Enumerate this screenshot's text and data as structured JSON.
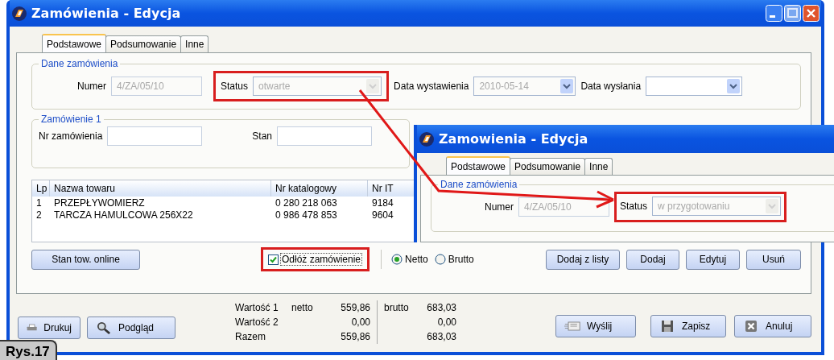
{
  "window": {
    "title": "Zamówienia - Edycja"
  },
  "tabs": [
    {
      "label": "Podstawowe",
      "selected": true
    },
    {
      "label": "Podsumowanie",
      "selected": false
    },
    {
      "label": "Inne",
      "selected": false
    }
  ],
  "order_data": {
    "legend": "Dane zamówienia",
    "numer": {
      "label": "Numer",
      "value": "4/ZA/05/10"
    },
    "status": {
      "label": "Status",
      "value": "otwarte",
      "highlighted": true
    },
    "issue_date": {
      "label": "Data wystawienia",
      "value": "2010-05-14"
    },
    "send_date": {
      "label": "Data wysłania"
    }
  },
  "order_1": {
    "legend": "Zamówienie 1",
    "fields": [
      {
        "label": "Nr zamówienia"
      },
      {
        "label": "Stan"
      }
    ]
  },
  "table": {
    "columns": [
      "Lp",
      "Nazwa towaru",
      "Nr katalogowy",
      "Nr IT"
    ],
    "rows": [
      [
        "1",
        "PRZEPŁYWOMIERZ",
        "0 280 218 063",
        "9184"
      ],
      [
        "2",
        "TARCZA HAMULCOWA 256X22",
        "0 986 478 853",
        "9604"
      ]
    ]
  },
  "stock_button": "Stan tow. online",
  "postpone": {
    "label": "Odłóż zamówienie",
    "checked": true,
    "highlighted": true
  },
  "price_mode": [
    {
      "label": "Netto",
      "selected": true
    },
    {
      "label": "Brutto",
      "selected": false
    }
  ],
  "item_buttons": [
    "Dodaj z listy",
    "Dodaj",
    "Edytuj",
    "Usuń"
  ],
  "totals": [
    {
      "label": "Wartość 1",
      "net_label": "netto",
      "net": "559,86",
      "gross_label": "brutto",
      "gross": "683,03"
    },
    {
      "label": "Wartość 2",
      "net": "0,00",
      "gross": "0,00"
    },
    {
      "label": "Razem",
      "net": "559,86",
      "gross": "683,03"
    }
  ],
  "footer_left": [
    {
      "label": "Drukuj",
      "kind": "print"
    },
    {
      "label": "Podgląd",
      "kind": "preview"
    }
  ],
  "footer_right": [
    {
      "label": "Wyślij",
      "kind": "send"
    },
    {
      "label": "Zapisz",
      "kind": "save"
    },
    {
      "label": "Anuluj",
      "kind": "cancel"
    }
  ],
  "inset": {
    "title": "Zamowienia - Edycja",
    "tabs": [
      {
        "label": "Podstawowe",
        "selected": true
      },
      {
        "label": "Podsumowanie",
        "selected": false
      },
      {
        "label": "Inne",
        "selected": false
      }
    ],
    "legend": "Dane zamówienia",
    "numer": {
      "label": "Numer",
      "value": "4/ZA/05/10"
    },
    "status": {
      "label": "Status",
      "value": "w przygotowaniu",
      "highlighted": true
    }
  },
  "caption": "Rys.17"
}
